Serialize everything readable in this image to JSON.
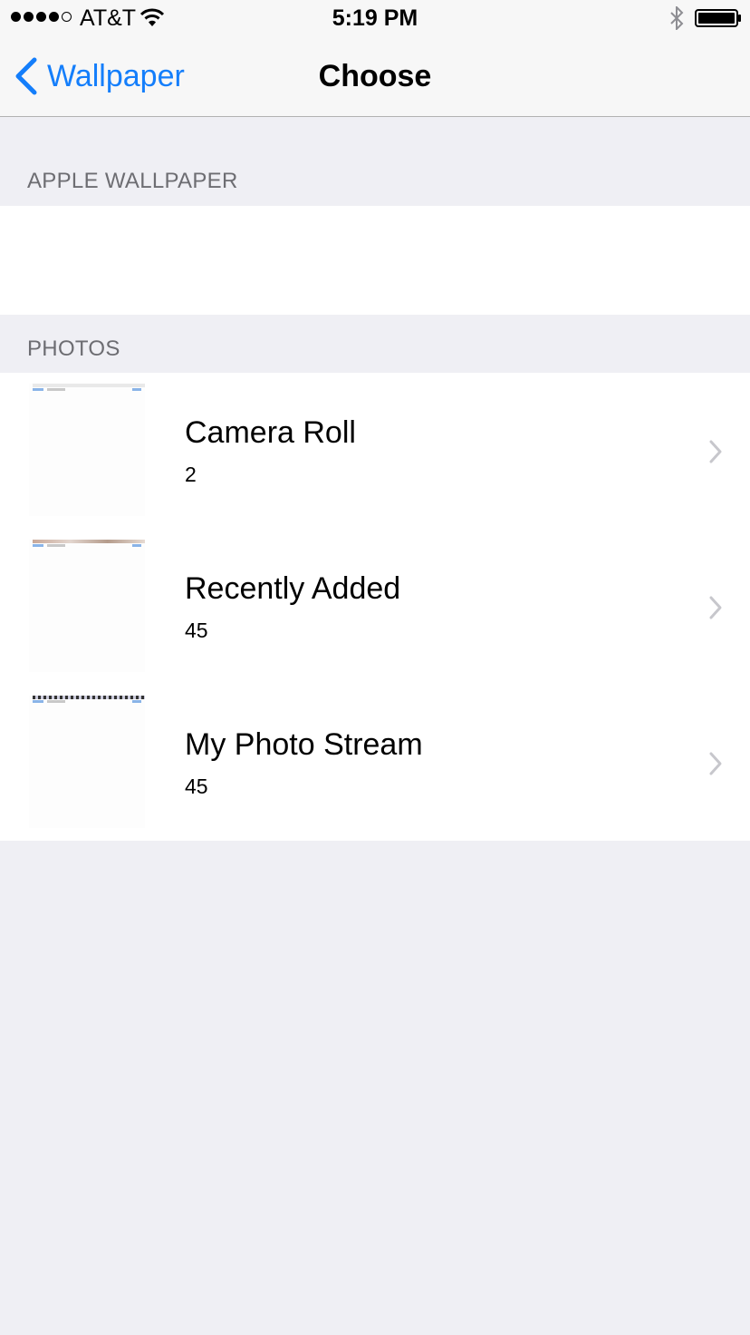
{
  "status_bar": {
    "signal_dots_filled": 4,
    "signal_dots_total": 5,
    "carrier": "AT&T",
    "time": "5:19 PM",
    "wifi_icon": "wifi-icon",
    "bluetooth_icon": "bluetooth-icon",
    "battery_icon": "battery-icon"
  },
  "nav_bar": {
    "back_label": "Wallpaper",
    "title": "Choose",
    "back_icon": "chevron-left-icon",
    "accent_color": "#147efb"
  },
  "sections": [
    {
      "header": "APPLE WALLPAPER"
    },
    {
      "header": "PHOTOS",
      "albums": [
        {
          "name": "Camera Roll",
          "count": "2"
        },
        {
          "name": "Recently Added",
          "count": "45"
        },
        {
          "name": "My Photo Stream",
          "count": "45"
        }
      ]
    }
  ],
  "colors": {
    "background": "#efeff4",
    "section_header": "#6d6d72",
    "disclosure": "#c7c7cc"
  }
}
